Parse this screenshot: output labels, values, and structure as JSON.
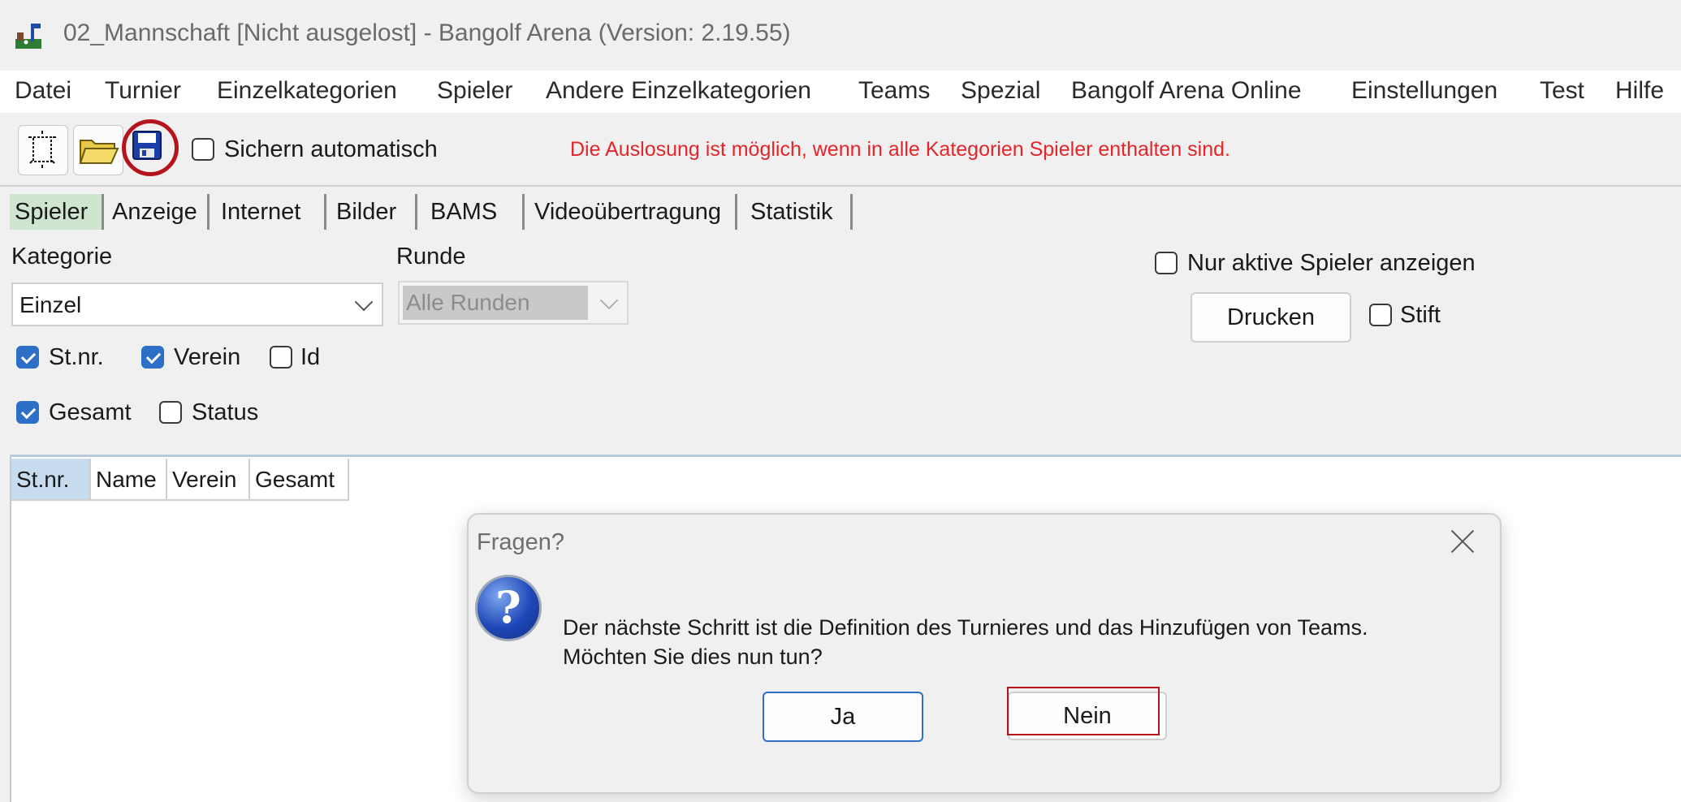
{
  "window": {
    "title": "02_Mannschaft [Nicht ausgelost] - Bangolf Arena (Version: 2.19.55)"
  },
  "menu": {
    "items": [
      "Datei",
      "Turnier",
      "Einzelkategorien",
      "Spieler",
      "Andere Einzelkategorien",
      "Teams",
      "Spezial",
      "Bangolf Arena Online",
      "Einstellungen",
      "Test",
      "Hilfe"
    ]
  },
  "toolbar": {
    "icons": [
      "new-file-icon",
      "open-folder-icon",
      "save-disk-icon"
    ],
    "auto_save_label": "Sichern automatisch",
    "auto_save_checked": false,
    "warning": "Die Auslosung ist möglich, wenn in alle Kategorien Spieler enthalten sind.",
    "warning_color": "#e4262b"
  },
  "tabs": [
    "Spieler",
    "Anzeige",
    "Internet",
    "Bilder",
    "BAMS",
    "Videoübertragung",
    "Statistik"
  ],
  "active_tab": "Spieler",
  "filters": {
    "kategorie_label": "Kategorie",
    "kategorie_value": "Einzel",
    "runde_label": "Runde",
    "runde_value": "Alle Runden",
    "nur_aktive_label": "Nur aktive Spieler anzeigen",
    "drucken_label": "Drucken",
    "stift_label": "Stift",
    "columns": [
      {
        "label": "St.nr.",
        "checked": true
      },
      {
        "label": "Verein",
        "checked": true
      },
      {
        "label": "Id",
        "checked": false
      },
      {
        "label": "Gesamt",
        "checked": true
      },
      {
        "label": "Status",
        "checked": false
      }
    ]
  },
  "grid": {
    "headers": [
      "St.nr.",
      "Name",
      "Verein",
      "Gesamt"
    ]
  },
  "dialog": {
    "title": "Fragen?",
    "message_line1": "Der nächste Schritt ist die Definition des Turnieres und das Hinzufügen von Teams.",
    "message_line2": "Möchten Sie dies nun tun?",
    "yes_label": "Ja",
    "no_label": "Nein"
  },
  "highlight_color": "#b5141c"
}
